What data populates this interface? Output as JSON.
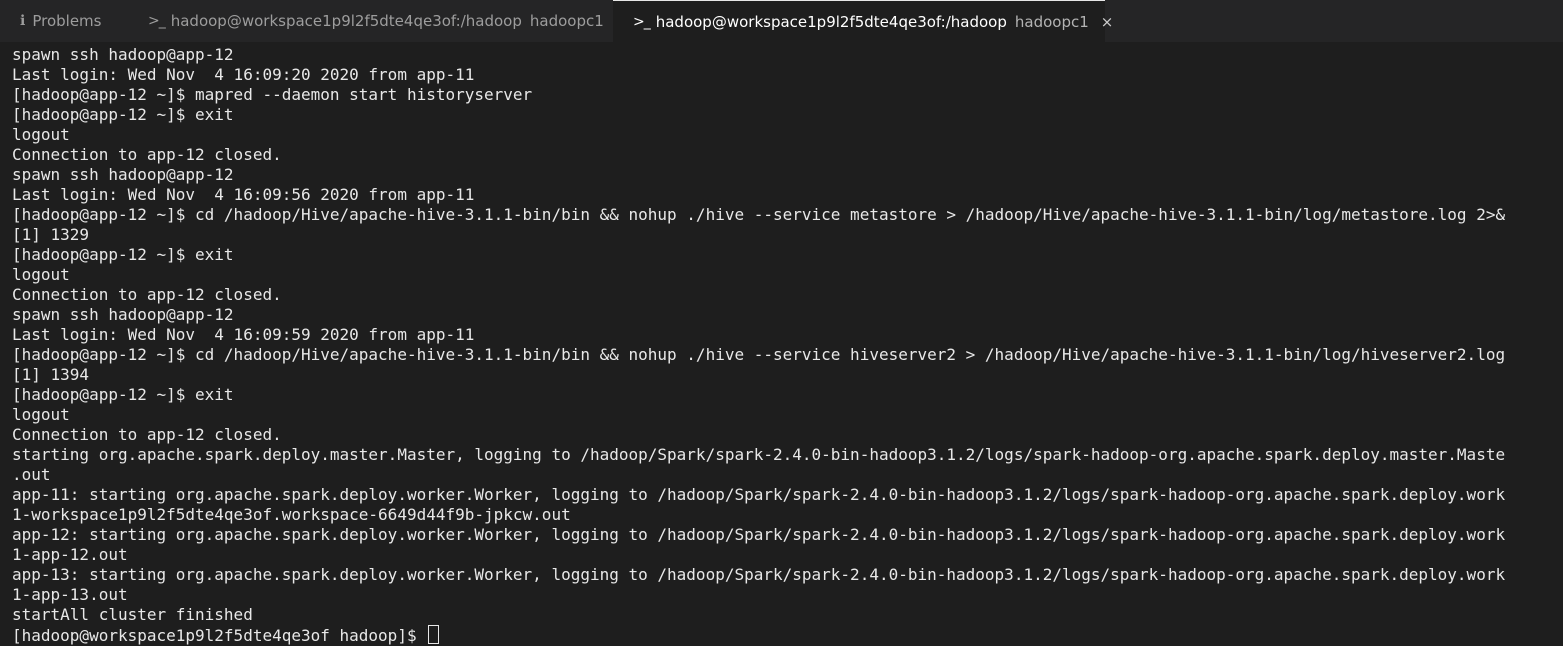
{
  "tabs": [
    {
      "label": "Problems",
      "icon": "info-icon"
    },
    {
      "label": "hadoop@workspace1p9l2f5dte4qe3of:/hadoop",
      "desc": "hadoopc1",
      "icon": "terminal-icon"
    },
    {
      "label": "hadoop@workspace1p9l2f5dte4qe3of:/hadoop",
      "desc": "hadoopc1",
      "icon": "terminal-icon",
      "close": "×"
    }
  ],
  "terminal": {
    "lines": [
      "spawn ssh hadoop@app-12",
      "Last login: Wed Nov  4 16:09:20 2020 from app-11",
      "[hadoop@app-12 ~]$ mapred --daemon start historyserver",
      "[hadoop@app-12 ~]$ exit",
      "logout",
      "Connection to app-12 closed.",
      "spawn ssh hadoop@app-12",
      "Last login: Wed Nov  4 16:09:56 2020 from app-11",
      "[hadoop@app-12 ~]$ cd /hadoop/Hive/apache-hive-3.1.1-bin/bin && nohup ./hive --service metastore > /hadoop/Hive/apache-hive-3.1.1-bin/log/metastore.log 2>&",
      "[1] 1329",
      "[hadoop@app-12 ~]$ exit",
      "logout",
      "Connection to app-12 closed.",
      "spawn ssh hadoop@app-12",
      "Last login: Wed Nov  4 16:09:59 2020 from app-11",
      "[hadoop@app-12 ~]$ cd /hadoop/Hive/apache-hive-3.1.1-bin/bin && nohup ./hive --service hiveserver2 > /hadoop/Hive/apache-hive-3.1.1-bin/log/hiveserver2.log",
      "[1] 1394",
      "[hadoop@app-12 ~]$ exit",
      "logout",
      "Connection to app-12 closed.",
      "starting org.apache.spark.deploy.master.Master, logging to /hadoop/Spark/spark-2.4.0-bin-hadoop3.1.2/logs/spark-hadoop-org.apache.spark.deploy.master.Maste",
      ".out",
      "app-11: starting org.apache.spark.deploy.worker.Worker, logging to /hadoop/Spark/spark-2.4.0-bin-hadoop3.1.2/logs/spark-hadoop-org.apache.spark.deploy.work",
      "1-workspace1p9l2f5dte4qe3of.workspace-6649d44f9b-jpkcw.out",
      "app-12: starting org.apache.spark.deploy.worker.Worker, logging to /hadoop/Spark/spark-2.4.0-bin-hadoop3.1.2/logs/spark-hadoop-org.apache.spark.deploy.work",
      "1-app-12.out",
      "app-13: starting org.apache.spark.deploy.worker.Worker, logging to /hadoop/Spark/spark-2.4.0-bin-hadoop3.1.2/logs/spark-hadoop-org.apache.spark.deploy.work",
      "1-app-13.out",
      "startAll cluster finished"
    ],
    "prompt": "[hadoop@workspace1p9l2f5dte4qe3of hadoop]$ "
  },
  "colors": {
    "background": "#1e1e1e",
    "tabbar": "#252526",
    "text": "#e8e8e8"
  }
}
